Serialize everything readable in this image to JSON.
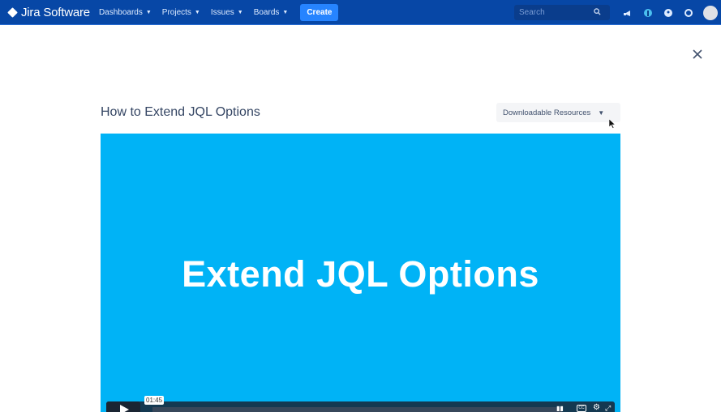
{
  "header": {
    "brand": "Jira Software",
    "nav": [
      {
        "label": "Dashboards"
      },
      {
        "label": "Projects"
      },
      {
        "label": "Issues"
      },
      {
        "label": "Boards"
      }
    ],
    "create_label": "Create",
    "search_placeholder": "Search",
    "icons": [
      "notifications-icon",
      "app-switcher-icon",
      "help-icon",
      "settings-icon",
      "avatar"
    ]
  },
  "modal": {
    "title": "How to Extend JQL Options",
    "resources_label": "Downloadable Resources",
    "close_icon": "close-icon"
  },
  "video": {
    "slide_title": "Extend JQL Options",
    "hover_time": "01:45",
    "background": "#00b3f6"
  },
  "colors": {
    "topbar": "#0747a6",
    "create": "#2684ff"
  }
}
